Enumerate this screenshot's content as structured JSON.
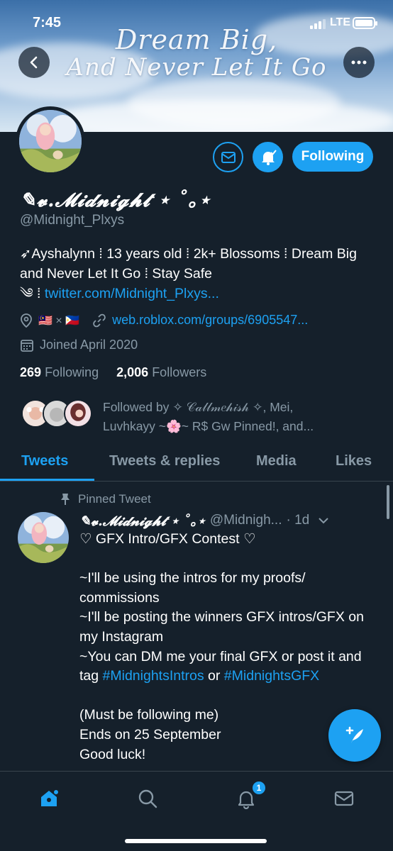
{
  "status_bar": {
    "time": "7:45",
    "network": "LTE"
  },
  "banner": {
    "line1": "Dream Big,",
    "line2": "And Never Let It Go"
  },
  "profile": {
    "name": "✎𝓿.𝓜𝓲𝓭𝓷𝓲𝓰𝓱𝓽 ⋆ ˚｡⋆",
    "handle": "@Midnight_Plxys",
    "bio_line1": "➶Ayshalynn ⁞ 13 years old ⁞ 2k+ Blossoms ⁞ Dream Big and Never Let It Go ⁞ Stay Safe",
    "bio_link_prefix": "༄ ⁞ ",
    "bio_link": "twitter.com/Midnight_Plxys...",
    "location": "🇲🇾 × 🇵🇭",
    "website": "web.roblox.com/groups/6905547...",
    "joined": "Joined April 2020",
    "following_count": "269",
    "following_label": "Following",
    "followers_count": "2,006",
    "followers_label": "Followers",
    "followed_by": "Followed by ✧ 𝒞𝒶𝓁𝓁𝓂𝑒𝒽𝒾𝓈𝒽 ✧, Mei, Luvhkayy ~🌸~ R$ Gw Pinned!, and..."
  },
  "buttons": {
    "following": "Following"
  },
  "tabs": [
    "Tweets",
    "Tweets & replies",
    "Media",
    "Likes"
  ],
  "pinned_tweet": {
    "label": "Pinned Tweet",
    "name": "✎𝓿.𝓜𝓲𝓭𝓷𝓲𝓰𝓱𝓽 ⋆ ˚｡⋆",
    "handle": "@Midnigh...",
    "time": "· 1d",
    "line1": "♡ GFX Intro/GFX Contest ♡",
    "line2": "~I'll be using the intros for my proofs/ commissions",
    "line3": "~I'll be posting the winners GFX intros/GFX on my Instagram",
    "line4_pre": "~You can DM me your final GFX or post it and tag ",
    "hashtag1": "#MidnightsIntros",
    "or": " or ",
    "hashtag2": "#MidnightsGFX",
    "line5": "(Must be following me)",
    "line6": "Ends on 25 September",
    "line7": "Good luck!"
  },
  "bottom_nav": {
    "notification_badge": "1"
  },
  "colors": {
    "background": "#15202b",
    "accent": "#1da1f2",
    "muted": "#8899a6",
    "divider": "#38444d"
  }
}
